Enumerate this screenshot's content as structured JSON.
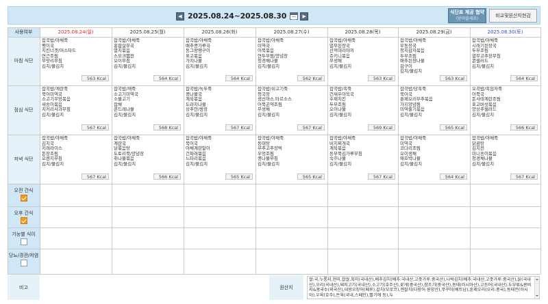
{
  "header": {
    "week_range": "2025.08.24~2025.08.30",
    "supply_button": {
      "line1": "식단표 제공 협약",
      "line2": "(받아올세요)"
    },
    "compare_button": "비교및원산지현감"
  },
  "table": {
    "use_header": "사용여부",
    "days": [
      "2025.08.24(일)",
      "2025.08.25(월)",
      "2025.08.26(화)",
      "2025.08.27(수)",
      "2025.08.28(목)",
      "2025.08.29(금)",
      "2025.08.30(토)"
    ],
    "colors": {
      "sunday": "#e02020",
      "saturday": "#2050d0",
      "accent": "#f29a1f",
      "header_bg": "#d0e8f5"
    }
  },
  "meals": [
    {
      "label": "아침 식단",
      "cells": [
        {
          "items": [
            "잡곡밥/야채죽",
            "팽이국",
            "치킨너겟/머스타드",
            "연근조림",
            "무맛리무침",
            "김치/물김치"
          ],
          "kcal": "563 Kcal"
        },
        {
          "items": [
            "잡곡밥/야채죽",
            "홍합살무국",
            "멸치볶음",
            "스모크햄전",
            "오이무침",
            "김치/물김치"
          ],
          "kcal": "564 Kcal"
        },
        {
          "items": [
            "잡곡밥/야채죽",
            "배추콩가루국",
            "동그랑땡구이",
            "표고볶음",
            "가지나물",
            "김치/물김치"
          ],
          "kcal": "564 Kcal"
        },
        {
          "items": [
            "잡곡밥/야채죽",
            "미역국",
            "어묵볶음",
            "연두부찜/양념장",
            "청경채나물",
            "김치/물김치"
          ],
          "kcal": "562 Kcal"
        },
        {
          "items": [
            "잡곡밥/야채죽",
            "열무된장국",
            "산적데리야끼",
            "쥬키니볶음",
            "무생채",
            "김치/물김치"
          ],
          "kcal": "563 Kcal"
        },
        {
          "items": [
            "잡곡밥/야채죽",
            "우동장국",
            "청치감자볶음",
            "두부조림",
            "배추된장나물",
            "감구이",
            "김치/물김치"
          ],
          "kcal": "563 Kcal"
        },
        {
          "items": [
            "잡곡밥/야채죽",
            "시래기된장국",
            "두부조림",
            "열무고추장무침",
            "콘샐러드",
            "김치/물김치"
          ],
          "kcal": "564 Kcal"
        }
      ]
    },
    {
      "label": "점심 식단",
      "cells": [
        {
          "items": [
            "잡곡밥/계란죽",
            "북어미역국",
            "소고기우엉볶음",
            "새송이볶음",
            "치커리사과무침",
            "김치/물김치"
          ],
          "kcal": "567 Kcal"
        },
        {
          "items": [
            "잡곡밥/깨죽",
            "소고기미역국",
            "소불고기",
            "잡채",
            "콘드레나물",
            "김치/물김치"
          ],
          "kcal": "568 Kcal"
        },
        {
          "items": [
            "잡곡밥/녹두죽",
            "콩나물국",
            "계육볶음",
            "도라지나물",
            "상추안/쌈장",
            "김치/물김치"
          ],
          "kcal": "567 Kcal"
        },
        {
          "items": [
            "잡곡밥/쇠고기죽",
            "청국장",
            "생선까스.타르소스",
            "어묵곤약조림",
            "무생채",
            "김치/물김치"
          ],
          "kcal": "567 Kcal"
        },
        {
          "items": [
            "잡곡밥/흑죽",
            "건새우아욱국",
            "수제치킨",
            "두부조림",
            "오이나물",
            "김치/물김치"
          ],
          "kcal": "569 Kcal"
        },
        {
          "items": [
            "잡곡밥/당흑죽",
            "북어국",
            "훈제오리부추볶음",
            "가지양념찜",
            "미역줄기볶음",
            "김치/물김치"
          ],
          "kcal": "565 Kcal"
        },
        {
          "items": [
            "오곡밥/흑임자죽",
            "어묵국",
            "돈사태계란조림",
            "표고버섯볶음",
            "양상추샐러드",
            "김치/물김치"
          ],
          "kcal": "566 Kcal"
        }
      ]
    },
    {
      "label": "저녁 식단",
      "cells": [
        {
          "items": [
            "잡곡밥/야채죽",
            "김치국",
            "키레라이스",
            "돈장조림",
            "오렌지무침",
            "김치/물김치"
          ],
          "kcal": "567 Kcal"
        },
        {
          "items": [
            "잡곡밥/야채죽",
            "계란국",
            "닭볶음탕",
            "도토리묵/양념장",
            "취나물볶음",
            "김치/물김치"
          ],
          "kcal": "566 Kcal"
        },
        {
          "items": [
            "잡곡밥/야채죽",
            "북어국",
            "야채계란말이",
            "건파래볶음",
            "느타리볶음",
            "김치/물김치"
          ],
          "kcal": "565 Kcal"
        },
        {
          "items": [
            "잡곡밥/야채죽",
            "동태탕",
            "부추고추장떡",
            "우엉조림",
            "콩나물무침",
            "김치/물김치"
          ],
          "kcal": "565 Kcal"
        },
        {
          "items": [
            "잡곡밥/야채죽",
            "비지찌개국",
            "계육볶음",
            "동부묵김가루무침",
            "숙주나물",
            "김치/물김치"
          ],
          "kcal": "567 Kcal"
        },
        {
          "items": [
            "잡곡밥/야채죽",
            "미역국",
            "코다리조림",
            "오이생채",
            "애호박나물",
            "김치/물김치"
          ],
          "kcal": "564 Kcal"
        },
        {
          "items": [
            "잡곡밥/야채죽",
            "닭곰탕",
            "김치전",
            "미니송이볶음",
            "청경채나물",
            "김치/물김치"
          ],
          "kcal": "567 Kcal"
        }
      ]
    }
  ],
  "extra_rows": [
    {
      "label": "오전 간식",
      "checked": true
    },
    {
      "label": "오후 간식",
      "checked": true
    },
    {
      "label": "기능별 식이",
      "checked": false
    },
    {
      "label": "당뇨/경관/저염",
      "checked": false
    }
  ],
  "footer": {
    "remark_label": "비고",
    "origin_label": "원산지",
    "origin_text": "쌀:국,누룽지,현미,찹쌀,흑미(국내산),배추김치(배추:국내산,고춧가루:중국산),나박김치(배추:국내산,고춧가루:중국산),닭(국내산),오리(국내산),돼지고기(국내산),소고기(호주산),꽃게(중국산),참조기(중국산),동태(러시아산),고등어(국내산),두부류&콩비지&콩국수(외국산),대왕오징어(페루),갈치(모로코),젠잘치(다랑어:원양산),쭈꾸미(베트남),훈제오리(오리:중국),동태전(러시아),우육(호주),돈육(국내,스페인),빨기에 등),두"
  }
}
